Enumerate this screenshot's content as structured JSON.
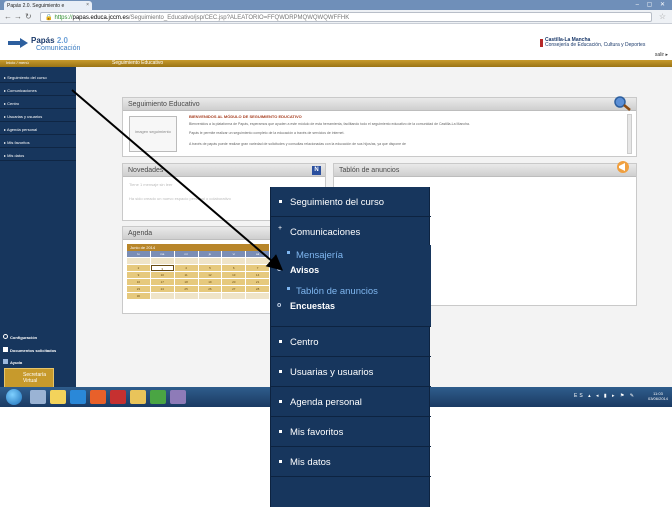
{
  "browser": {
    "tab_title": "Papás 2.0. Seguimiento e",
    "tab_close": "×",
    "window_controls": "– ▢ ✕",
    "url_https": "https://",
    "url_host": "papas.educa.jccm.es",
    "url_path": "/Seguimiento_Educativo/jsp/CEC.jsp?ALEATORIO=FFQWDRPMQWQWQWFFHK"
  },
  "header": {
    "logo_title": "Papás",
    "logo_version": "2.0",
    "logo_subtitle": "Comunicación",
    "gov_line1": "Castilla-La Mancha",
    "gov_line2": "Consejería de Educación, Cultura y Deportes",
    "salir": "salir ▸"
  },
  "goldbar": {
    "left_label": "Inicio / menú",
    "section": "Seguimiento Educativo"
  },
  "sidebar": {
    "items": [
      {
        "label": "▸ Seguimiento del curso"
      },
      {
        "label": "▸ Comunicaciones"
      },
      {
        "label": "▸ Centro"
      },
      {
        "label": "▸ Usuarias y usuarios"
      },
      {
        "label": "▸ Agenda personal"
      },
      {
        "label": "▸ Mis favoritos"
      },
      {
        "label": "▸ Mis datos"
      }
    ],
    "bottom": [
      {
        "label": "Configuración",
        "icon": "gear-icon"
      },
      {
        "label": "Documentos solicitados",
        "icon": "document-icon"
      },
      {
        "label": "Ayuda",
        "icon": "help-icon"
      }
    ],
    "secretaria": "Secretaría Virtual"
  },
  "main": {
    "seguimiento": {
      "title": "Seguimiento Educativo",
      "thumb_label": "imagen seguimiento",
      "heading": "BIENVENIDOS AL MÓDULO DE SEGUIMIENTO EDUCATIVO",
      "lines": [
        "Bienvenidos a la plataforma de Papás, esperamos que ayuden a este módulo de esta herramienta, facilitando todo el seguimiento educativo de la comunidad de Castilla-La Mancha.",
        "Papás le permite realizar un seguimiento completo de la educación a través de servicios de internet.",
        "A través de papás puede realizar gran variedad de solicitudes y consultas relacionadas con la educación de sus hijos/as, ya que dispone de"
      ]
    },
    "novedades": {
      "title": "Novedades",
      "badge": "N",
      "lines": [
        "Tiene 1 mensaje sin leer",
        "Ha sido creado un nuevo espacio personal o colaborativo"
      ]
    },
    "tablon": {
      "title": "Tablón de anuncios"
    },
    "agenda": {
      "title": "Agenda",
      "month": "Junio de 2014",
      "days_header": [
        "lu",
        "ma",
        "mi",
        "ju",
        "vi",
        "sá"
      ],
      "weeks": [
        [
          "",
          "",
          "",
          "",
          "",
          ""
        ],
        [
          "2",
          "3",
          "4",
          "5",
          "6",
          "7"
        ],
        [
          "9",
          "10",
          "11",
          "12",
          "13",
          "14"
        ],
        [
          "16",
          "17",
          "18",
          "19",
          "20",
          "21"
        ],
        [
          "23",
          "24",
          "25",
          "26",
          "27",
          "28"
        ],
        [
          "30",
          "",
          "",
          "",
          "",
          ""
        ]
      ],
      "today": "3"
    }
  },
  "taskbar": {
    "tray": "ES ▴ ◂ ▮ ▸ ⚑ ✎",
    "time": "11:03",
    "date": "03/06/2014"
  },
  "zoom_menu": {
    "items": [
      {
        "label": "Seguimiento del curso"
      },
      {
        "label": "Comunicaciones"
      },
      {
        "label": "Centro"
      },
      {
        "label": "Usuarias y usuarios"
      },
      {
        "label": "Agenda personal"
      },
      {
        "label": "Mis favoritos"
      },
      {
        "label": "Mis datos"
      }
    ],
    "submenu": [
      {
        "label": "Mensajería",
        "style": "blue"
      },
      {
        "label": "Avisos",
        "style": "white"
      },
      {
        "label": "Tablón de anuncios",
        "style": "blue"
      },
      {
        "label": "Encuestas",
        "style": "white"
      }
    ],
    "expanded_marker": "+"
  },
  "colors": {
    "sidebar_bg": "#17365d",
    "gold": "#c79a2c",
    "submenu_link": "#7fb6ef"
  }
}
